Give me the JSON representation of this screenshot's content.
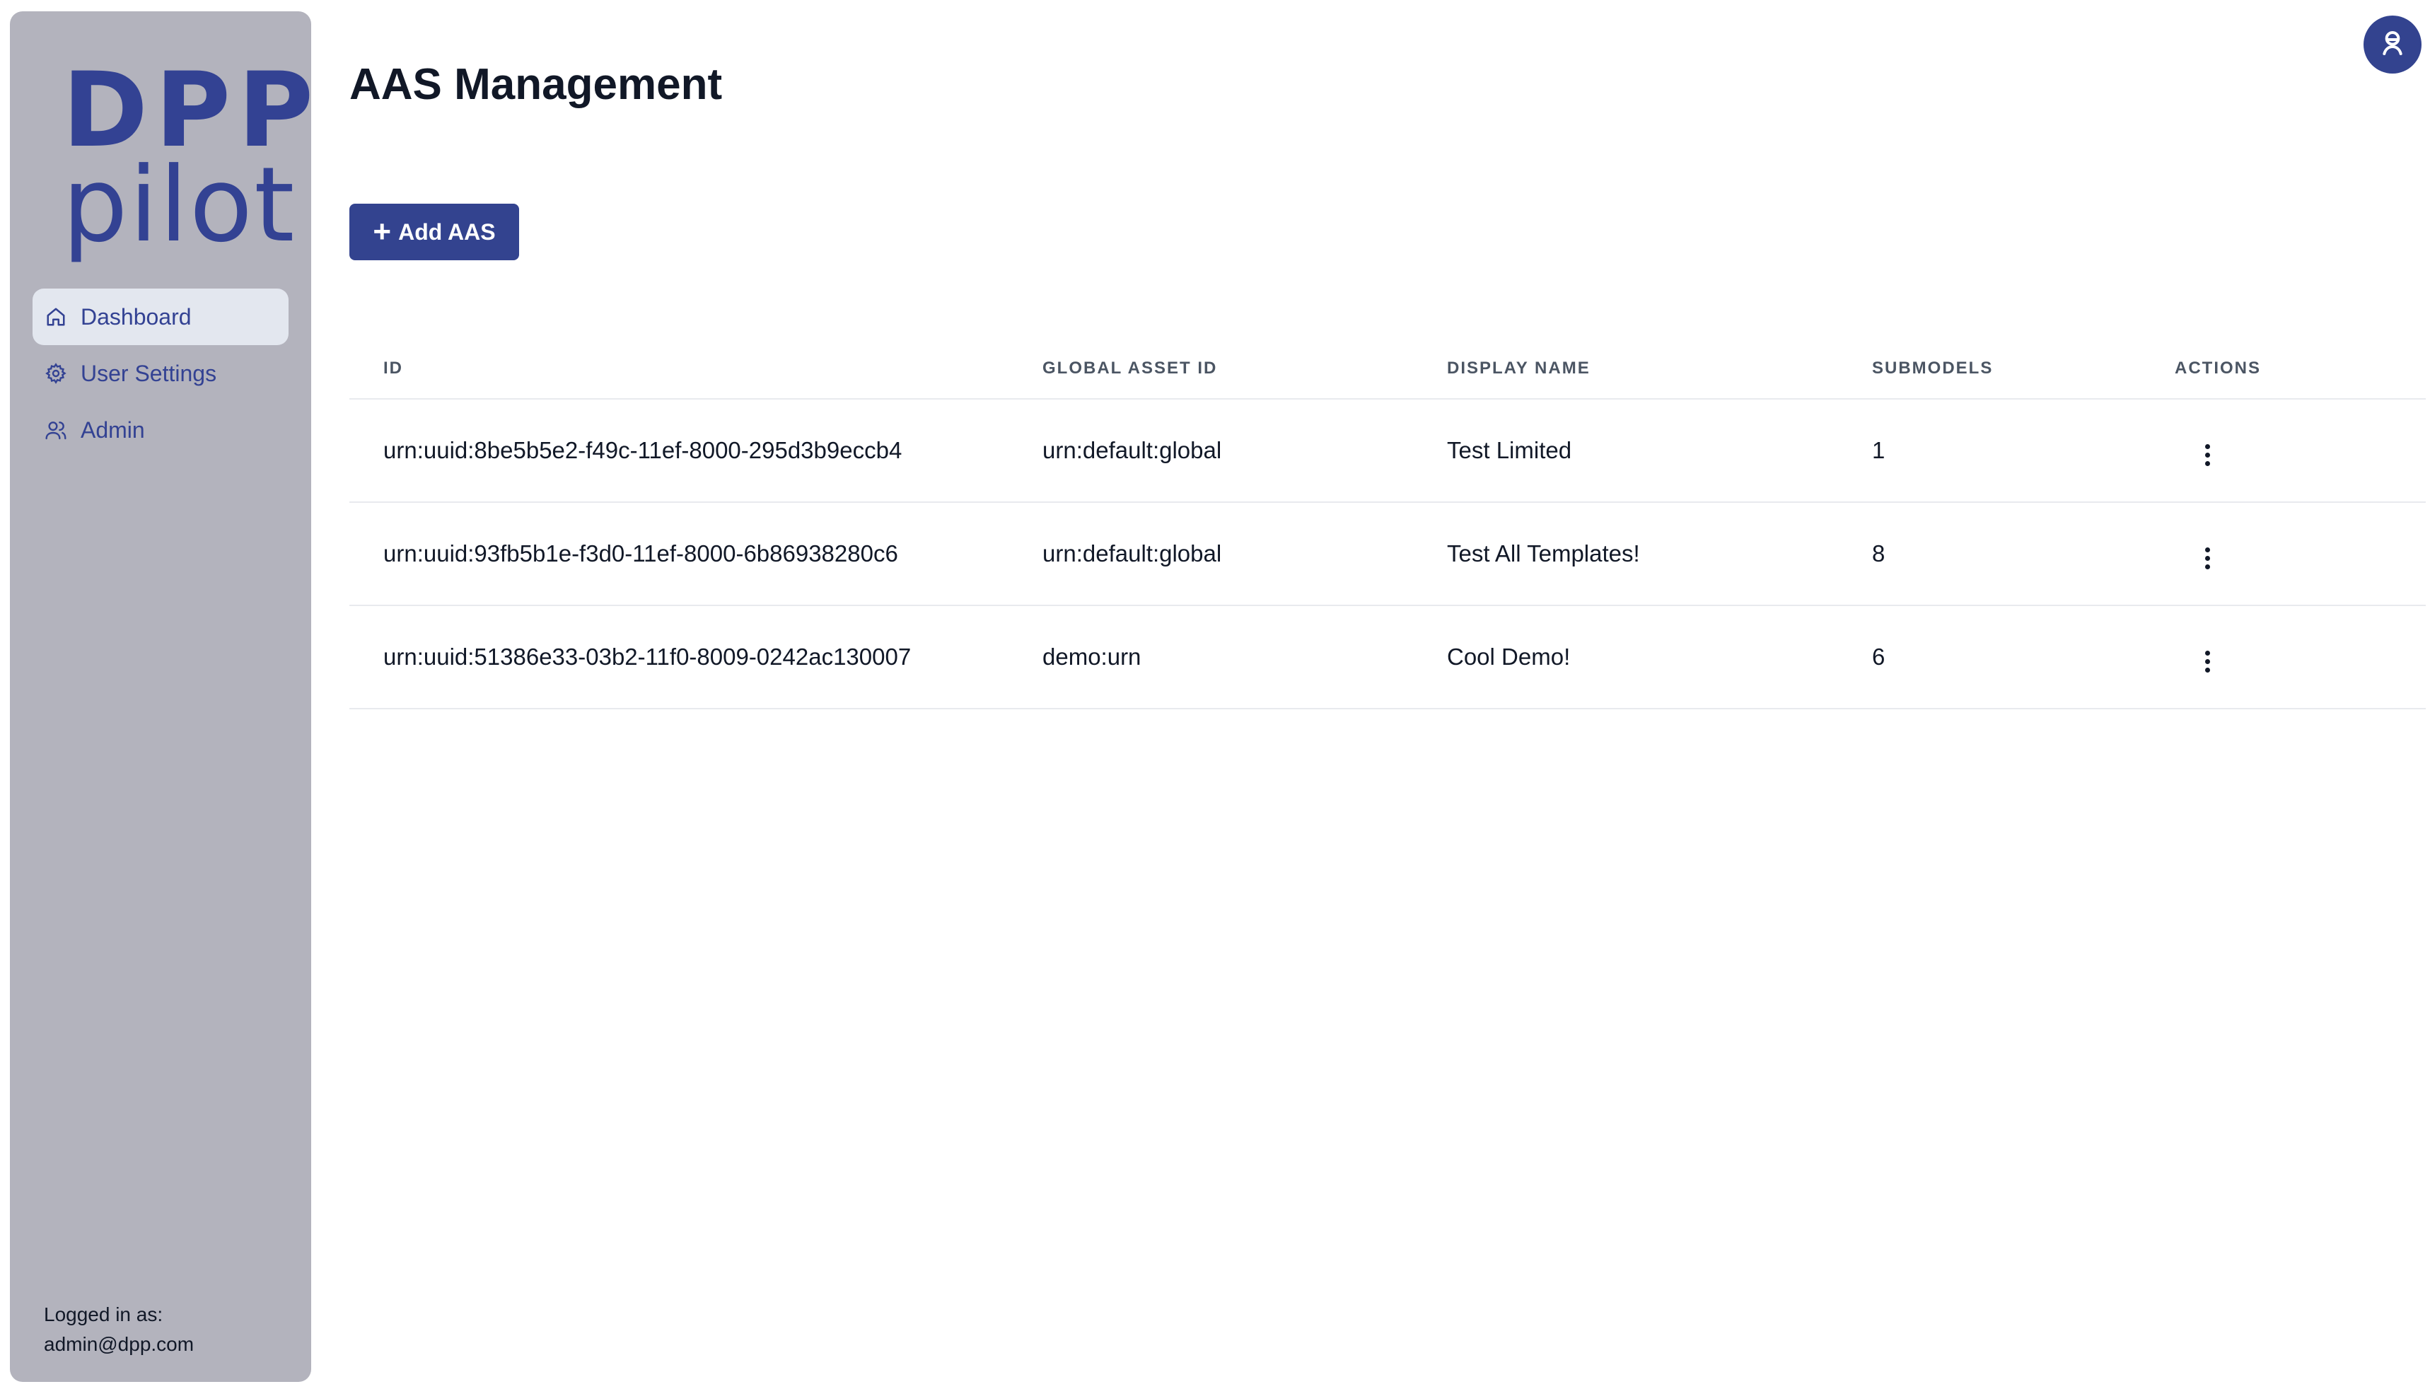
{
  "logo": {
    "line1": "DPP",
    "line2": "pilot"
  },
  "sidebar": {
    "items": [
      {
        "label": "Dashboard",
        "icon": "home-icon",
        "active": true
      },
      {
        "label": "User Settings",
        "icon": "gear-icon",
        "active": false
      },
      {
        "label": "Admin",
        "icon": "users-icon",
        "active": false
      }
    ],
    "login_label": "Logged in as:",
    "login_email": "admin@dpp.com"
  },
  "header": {
    "avatar_icon": "user-avatar-icon"
  },
  "main": {
    "title": "AAS Management",
    "add_button_label": "Add AAS",
    "table": {
      "headers": [
        "ID",
        "GLOBAL ASSET ID",
        "DISPLAY NAME",
        "SUBMODELS",
        "ACTIONS"
      ],
      "rows": [
        {
          "id": "urn:uuid:8be5b5e2-f49c-11ef-8000-295d3b9eccb4",
          "global_asset_id": "urn:default:global",
          "display_name": "Test Limited",
          "submodels": "1"
        },
        {
          "id": "urn:uuid:93fb5b1e-f3d0-11ef-8000-6b86938280c6",
          "global_asset_id": "urn:default:global",
          "display_name": "Test All Templates!",
          "submodels": "8"
        },
        {
          "id": "urn:uuid:51386e33-03b2-11f0-8009-0242ac130007",
          "global_asset_id": "demo:urn",
          "display_name": "Cool Demo!",
          "submodels": "6"
        }
      ]
    }
  },
  "colors": {
    "brand": "#334293",
    "sidebar_bg": "#b3b3bd",
    "active_item_bg": "#e3e7ef"
  }
}
